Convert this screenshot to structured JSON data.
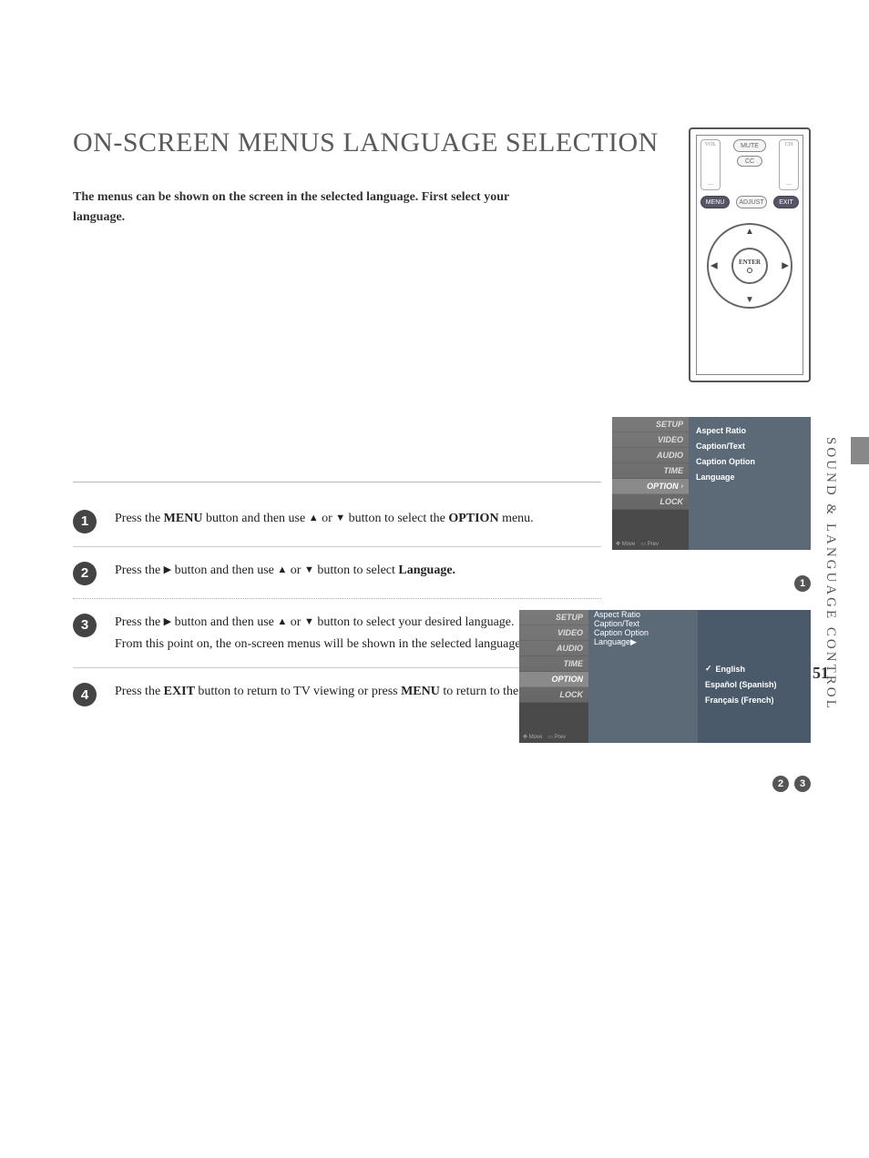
{
  "title": "ON-SCREEN MENUS LANGUAGE SELECTION",
  "intro": "The menus can be shown on the screen in the selected language. First select your language.",
  "side_text": "SOUND & LANGUAGE CONTROL",
  "page_number": "51",
  "remote": {
    "vol": "VOL",
    "mute": "MUTE",
    "cc": "CC",
    "ch": "CH",
    "menu": "MENU",
    "adjust": "ADJUST",
    "exit": "EXIT",
    "enter": "ENTER",
    "minus": "—"
  },
  "steps": [
    {
      "num": "1",
      "pre": "Press the ",
      "btn1": "MENU",
      "mid1": " button and then use ",
      "mid2": " or ",
      "mid3": " button to select the ",
      "btn2": "OPTION",
      "post": " menu."
    },
    {
      "num": "2",
      "pre": "Press the ",
      "mid1": " button and then use ",
      "mid2": " or ",
      "mid3": " button to select ",
      "btn2": "Language.",
      "post": ""
    },
    {
      "num": "3",
      "pre": "Press the ",
      "mid1": " button and then use ",
      "mid2": " or ",
      "mid3": " button to select your desired language.",
      "extra": "From this point on, the on-screen menus will be shown in the selected language."
    },
    {
      "num": "4",
      "pre": "Press the ",
      "btn1": "EXIT",
      "mid1": " button to return to TV viewing or press ",
      "btn2": "MENU",
      "post": " to return to the previous menu."
    }
  ],
  "osd": {
    "tabs": [
      "SETUP",
      "VIDEO",
      "AUDIO",
      "TIME",
      "OPTION",
      "LOCK"
    ],
    "items": [
      "Aspect Ratio",
      "Caption/Text",
      "Caption Option",
      "Language"
    ],
    "footer_move": "Move",
    "footer_prev": "Prev",
    "languages": [
      "English",
      "Español (Spanish)",
      "Français (French)"
    ]
  },
  "badges": {
    "b1": "1",
    "b2": "2",
    "b3": "3"
  }
}
